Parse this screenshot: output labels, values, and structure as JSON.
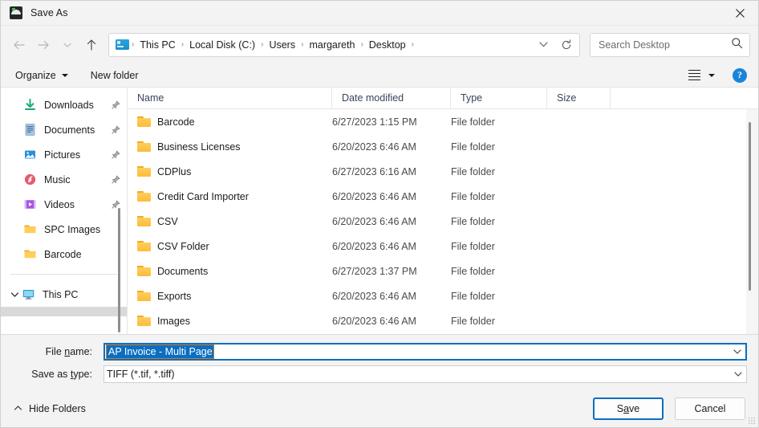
{
  "window": {
    "title": "Save As",
    "app_icon": "scanner-icon",
    "close_label": "×"
  },
  "nav": {
    "back": "back-arrow",
    "forward": "forward-arrow",
    "recent": "chevron-down",
    "up": "up-arrow",
    "breadcrumbs": [
      "This PC",
      "Local Disk (C:)",
      "Users",
      "margareth",
      "Desktop"
    ],
    "separator": "›",
    "dropdown": "⌄",
    "refresh": "↻"
  },
  "search": {
    "placeholder": "Search Desktop",
    "icon": "search-icon"
  },
  "commandbar": {
    "organize": "Organize",
    "new_folder": "New folder",
    "view_icon": "list-view-icon",
    "view_chevron": "▾",
    "help": "?"
  },
  "sidebar": {
    "items": [
      {
        "label": "Downloads",
        "icon": "download-icon",
        "pinned": true
      },
      {
        "label": "Documents",
        "icon": "document-icon",
        "pinned": true
      },
      {
        "label": "Pictures",
        "icon": "pictures-icon",
        "pinned": true
      },
      {
        "label": "Music",
        "icon": "music-icon",
        "pinned": true
      },
      {
        "label": "Videos",
        "icon": "video-icon",
        "pinned": true
      },
      {
        "label": "SPC Images",
        "icon": "folder-icon",
        "pinned": false
      },
      {
        "label": "Barcode",
        "icon": "folder-icon",
        "pinned": false
      }
    ],
    "tree": {
      "label": "This PC",
      "icon": "monitor-icon",
      "chevron": "⌄"
    }
  },
  "filelist": {
    "columns": [
      "Name",
      "Date modified",
      "Type",
      "Size"
    ],
    "sort_indicator": "⌃",
    "rows": [
      {
        "name": "Barcode",
        "date": "6/27/2023 1:15 PM",
        "type": "File folder",
        "size": ""
      },
      {
        "name": "Business Licenses",
        "date": "6/20/2023 6:46 AM",
        "type": "File folder",
        "size": ""
      },
      {
        "name": "CDPlus",
        "date": "6/27/2023 6:16 AM",
        "type": "File folder",
        "size": ""
      },
      {
        "name": "Credit Card Importer",
        "date": "6/20/2023 6:46 AM",
        "type": "File folder",
        "size": ""
      },
      {
        "name": "CSV",
        "date": "6/20/2023 6:46 AM",
        "type": "File folder",
        "size": ""
      },
      {
        "name": "CSV Folder",
        "date": "6/20/2023 6:46 AM",
        "type": "File folder",
        "size": ""
      },
      {
        "name": "Documents",
        "date": "6/27/2023 1:37 PM",
        "type": "File folder",
        "size": ""
      },
      {
        "name": "Exports",
        "date": "6/20/2023 6:46 AM",
        "type": "File folder",
        "size": ""
      },
      {
        "name": "Images",
        "date": "6/20/2023 6:46 AM",
        "type": "File folder",
        "size": ""
      }
    ]
  },
  "form": {
    "filename_label_pre": "File ",
    "filename_label_key": "n",
    "filename_label_post": "ame:",
    "filename_value": "AP Invoice - Multi Page",
    "filetype_label_pre": "Save as ",
    "filetype_label_key": "t",
    "filetype_label_post": "ype:",
    "filetype_value": "TIFF (*.tif, *.tiff)",
    "combo_arrow": "⌄"
  },
  "footer": {
    "hide_folders": "Hide Folders",
    "hide_chevron": "⌃",
    "save_pre": "S",
    "save_key": "a",
    "save_post": "ve",
    "cancel": "Cancel"
  },
  "colors": {
    "accent": "#0b6ec1",
    "selection": "#0b6ec1",
    "folder": "#ffcf5c",
    "help_blue": "#1a84d8",
    "window_bg": "#f3f3f3"
  }
}
